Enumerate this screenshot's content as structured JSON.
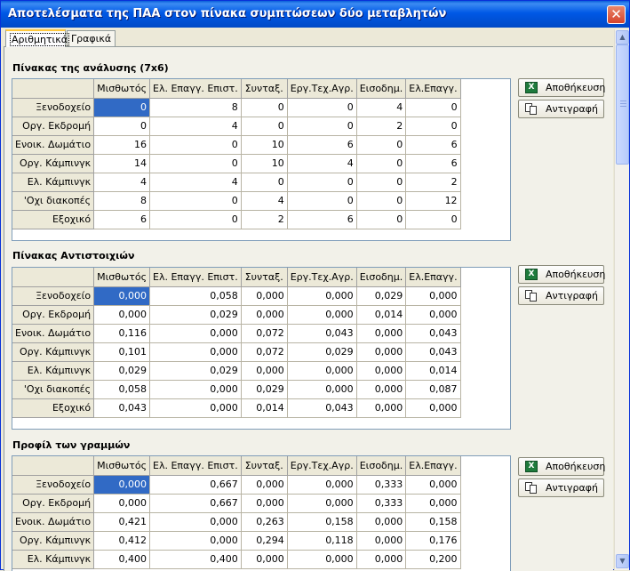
{
  "window": {
    "title": "Αποτελέσματα της ΠΑΑ στον πίνακα συμπτώσεων δύο μεταβλητών",
    "close_symbol": "✕",
    "accent_color": "#0058e6"
  },
  "tabs": [
    {
      "label": "Αριθμητικά",
      "active": true
    },
    {
      "label": "Γραφικά",
      "active": false
    }
  ],
  "buttons": {
    "save_label": "Αποθήκευση",
    "copy_label": "Αντιγραφή",
    "save_icon": "excel-icon",
    "copy_icon": "copy-icon",
    "save_icon_glyph": "X"
  },
  "columns": [
    "Μισθωτός",
    "Ελ. Επαγγ. Επιστ.",
    "Συνταξ.",
    "Εργ.Τεχ.Αγρ.",
    "Εισοδημ.",
    "Ελ.Επαγγ."
  ],
  "sections": [
    {
      "title": "Πίνακας της ανάλυσης (7x6)",
      "rows": [
        {
          "label": "Ξενοδοχείο",
          "values": [
            "0",
            "8",
            "0",
            "0",
            "4",
            "0"
          ]
        },
        {
          "label": "Οργ. Εκδρομή",
          "values": [
            "0",
            "4",
            "0",
            "0",
            "2",
            "0"
          ]
        },
        {
          "label": "Ενοικ. Δωμάτιο",
          "values": [
            "16",
            "0",
            "10",
            "6",
            "0",
            "6"
          ]
        },
        {
          "label": "Οργ. Κάμπινγκ",
          "values": [
            "14",
            "0",
            "10",
            "4",
            "0",
            "6"
          ]
        },
        {
          "label": "Ελ. Κάμπινγκ",
          "values": [
            "4",
            "4",
            "0",
            "0",
            "0",
            "2"
          ]
        },
        {
          "label": "'Οχι διακοπές",
          "values": [
            "8",
            "0",
            "4",
            "0",
            "0",
            "12"
          ]
        },
        {
          "label": "Εξοχικό",
          "values": [
            "6",
            "0",
            "2",
            "6",
            "0",
            "0"
          ]
        }
      ]
    },
    {
      "title": "Πίνακας Αντιστοιχιών",
      "rows": [
        {
          "label": "Ξενοδοχείο",
          "values": [
            "0,000",
            "0,058",
            "0,000",
            "0,000",
            "0,029",
            "0,000"
          ]
        },
        {
          "label": "Οργ. Εκδρομή",
          "values": [
            "0,000",
            "0,029",
            "0,000",
            "0,000",
            "0,014",
            "0,000"
          ]
        },
        {
          "label": "Ενοικ. Δωμάτιο",
          "values": [
            "0,116",
            "0,000",
            "0,072",
            "0,043",
            "0,000",
            "0,043"
          ]
        },
        {
          "label": "Οργ. Κάμπινγκ",
          "values": [
            "0,101",
            "0,000",
            "0,072",
            "0,029",
            "0,000",
            "0,043"
          ]
        },
        {
          "label": "Ελ. Κάμπινγκ",
          "values": [
            "0,029",
            "0,029",
            "0,000",
            "0,000",
            "0,000",
            "0,014"
          ]
        },
        {
          "label": "'Οχι διακοπές",
          "values": [
            "0,058",
            "0,000",
            "0,029",
            "0,000",
            "0,000",
            "0,087"
          ]
        },
        {
          "label": "Εξοχικό",
          "values": [
            "0,043",
            "0,000",
            "0,014",
            "0,043",
            "0,000",
            "0,000"
          ]
        }
      ]
    },
    {
      "title": "Προφίλ των γραμμών",
      "rows": [
        {
          "label": "Ξενοδοχείο",
          "values": [
            "0,000",
            "0,667",
            "0,000",
            "0,000",
            "0,333",
            "0,000"
          ]
        },
        {
          "label": "Οργ. Εκδρομή",
          "values": [
            "0,000",
            "0,667",
            "0,000",
            "0,000",
            "0,333",
            "0,000"
          ]
        },
        {
          "label": "Ενοικ. Δωμάτιο",
          "values": [
            "0,421",
            "0,000",
            "0,263",
            "0,158",
            "0,000",
            "0,158"
          ]
        },
        {
          "label": "Οργ. Κάμπινγκ",
          "values": [
            "0,412",
            "0,000",
            "0,294",
            "0,118",
            "0,000",
            "0,176"
          ]
        },
        {
          "label": "Ελ. Κάμπινγκ",
          "values": [
            "0,400",
            "0,400",
            "0,000",
            "0,000",
            "0,000",
            "0,200"
          ]
        }
      ]
    }
  ],
  "scrollbar": {
    "up_glyph": "▲",
    "down_glyph": "▼"
  }
}
